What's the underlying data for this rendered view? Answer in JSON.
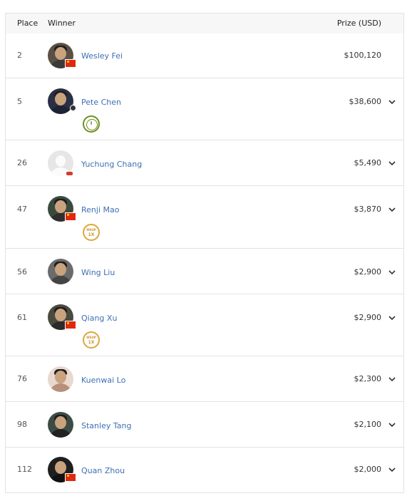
{
  "header": {
    "place": "Place",
    "winner": "Winner",
    "prize": "Prize (USD)"
  },
  "rows": [
    {
      "place": "2",
      "name": "Wesley Fei",
      "prize": "$100,120",
      "expandable": false,
      "badge": "flag-cn",
      "medal": null
    },
    {
      "place": "5",
      "name": "Pete Chen",
      "prize": "$38,600",
      "expandable": true,
      "badge": "dot",
      "medal": {
        "type": "green",
        "text": "I"
      }
    },
    {
      "place": "26",
      "name": "Yuchung Chang",
      "prize": "$5,490",
      "expandable": true,
      "badge": "dot-red",
      "medal": null
    },
    {
      "place": "47",
      "name": "Renji Mao",
      "prize": "$3,870",
      "expandable": true,
      "badge": "flag-cn",
      "medal": {
        "type": "gold",
        "line1": "WSOP",
        "line2": "1X"
      }
    },
    {
      "place": "56",
      "name": "Wing Liu",
      "prize": "$2,900",
      "expandable": true,
      "badge": null,
      "medal": null
    },
    {
      "place": "61",
      "name": "Qiang Xu",
      "prize": "$2,900",
      "expandable": true,
      "badge": "flag-cn",
      "medal": {
        "type": "gold",
        "line1": "WSOP",
        "line2": "1X"
      }
    },
    {
      "place": "76",
      "name": "Kuenwai Lo",
      "prize": "$2,300",
      "expandable": true,
      "badge": null,
      "medal": null
    },
    {
      "place": "98",
      "name": "Stanley Tang",
      "prize": "$2,100",
      "expandable": true,
      "badge": null,
      "medal": null
    },
    {
      "place": "112",
      "name": "Quan Zhou",
      "prize": "$2,000",
      "expandable": true,
      "badge": "flag-cn",
      "medal": null
    }
  ],
  "icons": {
    "expand": "chevron-down-icon",
    "flag": "china-flag-icon",
    "medal_green": "bracelet-medal-icon",
    "medal_gold": "wsop-medal-icon"
  },
  "colors": {
    "link": "#3e6fb5",
    "header_bg": "#f7f7f7",
    "border": "#e2e2e2",
    "flag_red": "#de2910",
    "medal_green": "#6e8f1f",
    "medal_gold": "#d9a83a"
  }
}
